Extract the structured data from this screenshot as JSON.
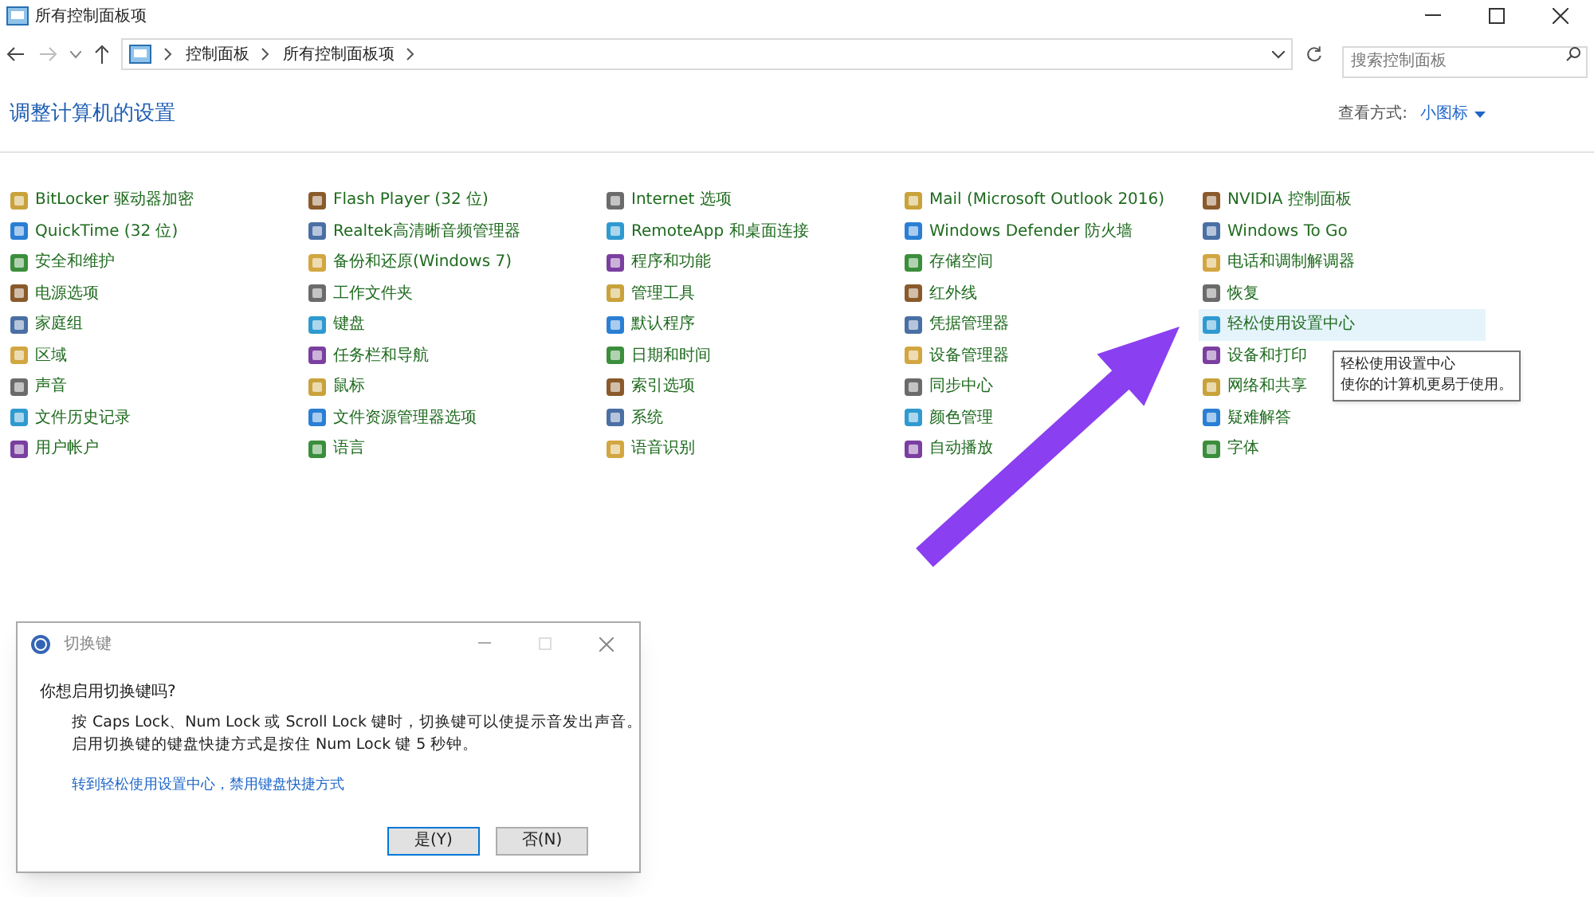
{
  "window": {
    "title": "所有控制面板项"
  },
  "address": {
    "crumbs": [
      "控制面板",
      "所有控制面板项"
    ]
  },
  "search": {
    "placeholder": "搜索控制面板"
  },
  "heading": "调整计算机的设置",
  "view": {
    "label": "查看方式:",
    "value": "小图标"
  },
  "columns": [
    [
      {
        "label": "BitLocker 驱动器加密",
        "selected": false
      },
      {
        "label": "QuickTime (32 位)",
        "selected": false
      },
      {
        "label": "安全和维护",
        "selected": false
      },
      {
        "label": "电源选项",
        "selected": false
      },
      {
        "label": "家庭组",
        "selected": false
      },
      {
        "label": "区域",
        "selected": false
      },
      {
        "label": "声音",
        "selected": false
      },
      {
        "label": "文件历史记录",
        "selected": false
      },
      {
        "label": "用户帐户",
        "selected": false
      }
    ],
    [
      {
        "label": "Flash Player (32 位)",
        "selected": false
      },
      {
        "label": "Realtek高清晰音频管理器",
        "selected": false
      },
      {
        "label": "备份和还原(Windows 7)",
        "selected": false
      },
      {
        "label": "工作文件夹",
        "selected": false
      },
      {
        "label": "键盘",
        "selected": false
      },
      {
        "label": "任务栏和导航",
        "selected": false
      },
      {
        "label": "鼠标",
        "selected": false
      },
      {
        "label": "文件资源管理器选项",
        "selected": false
      },
      {
        "label": "语言",
        "selected": false
      }
    ],
    [
      {
        "label": "Internet 选项",
        "selected": false
      },
      {
        "label": "RemoteApp 和桌面连接",
        "selected": false
      },
      {
        "label": "程序和功能",
        "selected": false
      },
      {
        "label": "管理工具",
        "selected": false
      },
      {
        "label": "默认程序",
        "selected": false
      },
      {
        "label": "日期和时间",
        "selected": false
      },
      {
        "label": "索引选项",
        "selected": false
      },
      {
        "label": "系统",
        "selected": false
      },
      {
        "label": "语音识别",
        "selected": false
      }
    ],
    [
      {
        "label": "Mail (Microsoft Outlook 2016)",
        "selected": false
      },
      {
        "label": "Windows Defender 防火墙",
        "selected": false
      },
      {
        "label": "存储空间",
        "selected": false
      },
      {
        "label": "红外线",
        "selected": false
      },
      {
        "label": "凭据管理器",
        "selected": false
      },
      {
        "label": "设备管理器",
        "selected": false
      },
      {
        "label": "同步中心",
        "selected": false
      },
      {
        "label": "颜色管理",
        "selected": false
      },
      {
        "label": "自动播放",
        "selected": false
      }
    ],
    [
      {
        "label": "NVIDIA 控制面板",
        "selected": false
      },
      {
        "label": "Windows To Go",
        "selected": false
      },
      {
        "label": "电话和调制解调器",
        "selected": false
      },
      {
        "label": "恢复",
        "selected": false
      },
      {
        "label": "轻松使用设置中心",
        "selected": true
      },
      {
        "label": "设备和打印",
        "selected": false
      },
      {
        "label": "网络和共享",
        "selected": false
      },
      {
        "label": "疑难解答",
        "selected": false
      },
      {
        "label": "字体",
        "selected": false
      }
    ]
  ],
  "tooltip": {
    "title": "轻松使用设置中心",
    "text": "使你的计算机更易于使用。"
  },
  "dialog": {
    "title": "切换键",
    "question": "你想启用切换键吗?",
    "lines": [
      "按 Caps Lock、Num Lock 或 Scroll Lock 键时，切换键可以使提示音发出声音。",
      "启用切换键的键盘快捷方式是按住 Num Lock 键 5 秒钟。"
    ],
    "link": "转到轻松使用设置中心，禁用键盘快捷方式",
    "buttons": [
      "是(Y)",
      "否(N)"
    ]
  }
}
